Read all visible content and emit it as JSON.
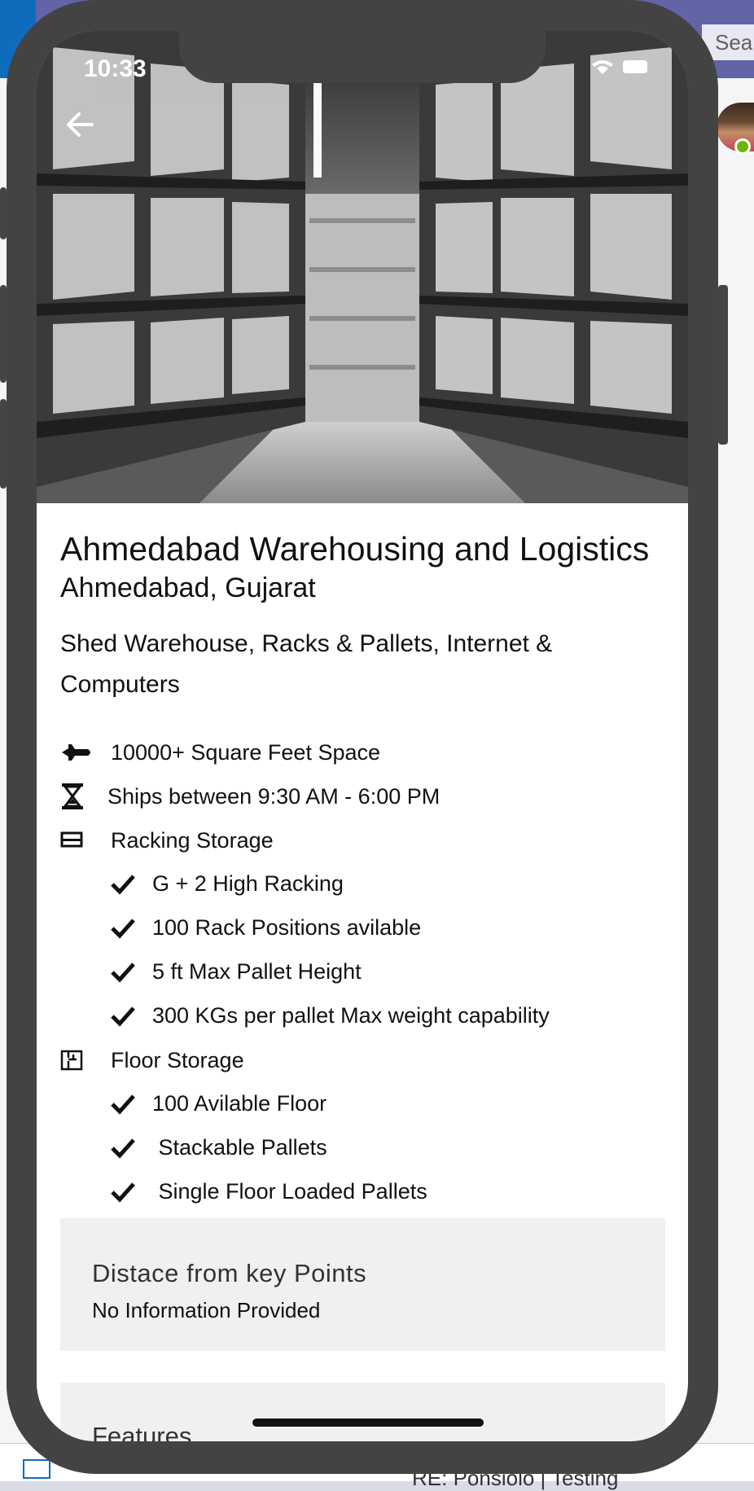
{
  "background": {
    "search_text": "Sear",
    "email_subject": "RE: Ponsiolo | Testing"
  },
  "status_bar": {
    "time": "10:33"
  },
  "listing": {
    "title": "Ahmedabad Warehousing and Logistics",
    "location": "Ahmedabad, Gujarat",
    "facilities": "Shed Warehouse, Racks & Pallets, Internet & Computers",
    "space": "10000+ Square Feet Space",
    "hours": "Ships between 9:30 AM - 6:00 PM",
    "racking": {
      "label": "Racking Storage",
      "items": [
        "G + 2 High Racking",
        "100 Rack Positions avilable",
        "5 ft Max Pallet Height",
        "300 KGs per pallet Max weight capability"
      ]
    },
    "floor": {
      "label": "Floor Storage",
      "items": [
        "100 Avilable Floor",
        " Stackable Pallets",
        " Single Floor Loaded Pallets"
      ]
    }
  },
  "distance_card": {
    "title": "Distace from key Points",
    "text": "No Information Provided"
  },
  "features_card": {
    "title": "Features"
  },
  "icons": {
    "back": "arrow-left-icon",
    "space": "airplane-icon",
    "hours": "hourglass-icon",
    "racking": "rack-icon",
    "floor": "floor-plan-icon",
    "check": "checkmark-icon"
  }
}
